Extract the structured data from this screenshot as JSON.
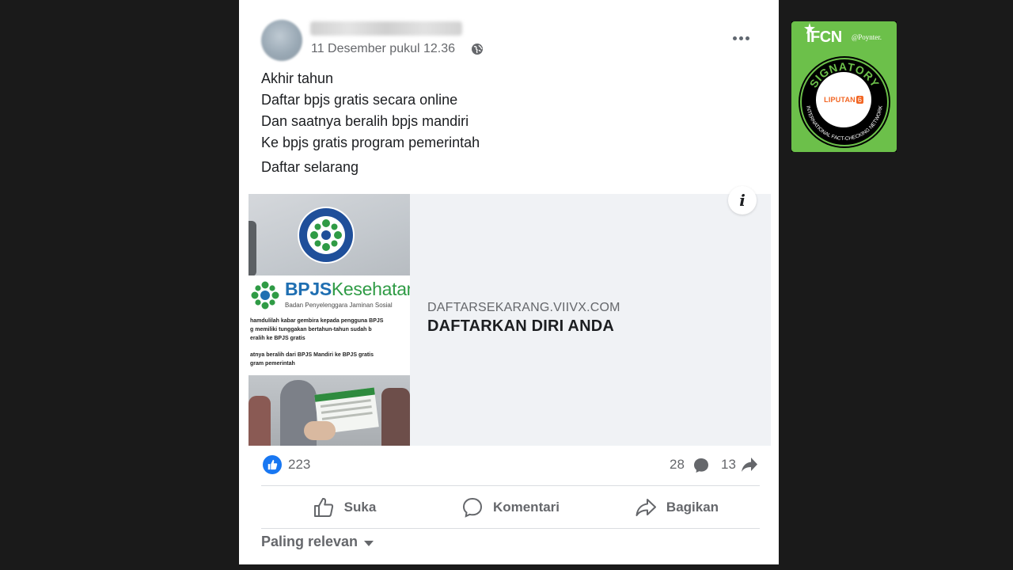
{
  "post": {
    "timestamp": "11 Desember pukul 12.36",
    "privacy_icon": "globe-icon",
    "text_lines": [
      "Akhir tahun",
      "Daftar bpjs gratis secara online",
      "Dan saatnya beralih bpjs mandiri",
      "Ke bpjs gratis program pemerintah"
    ],
    "cta_line": "Daftar selarang"
  },
  "link_preview": {
    "domain": "DAFTARSEKARANG.VIIVX.COM",
    "title": "DAFTARKAN DIRI ANDA",
    "info_label": "i",
    "thumbnail": {
      "brand_main": "BPJS",
      "brand_accent": "Kesehatan",
      "brand_sub": "Badan Penyelenggara Jaminan Sosial",
      "body_lines": [
        "hamdulilah kabar gembira kepada pengguna BPJS",
        "g memiliki tunggakan bertahun-tahun sudah b",
        "eralih ke BPJS gratis",
        "atnya beralih dari BPJS Mandiri ke BPJS gratis",
        "gram pemerintah"
      ]
    }
  },
  "stats": {
    "reactions": "223",
    "comments": "28",
    "shares": "13"
  },
  "actions": {
    "like": "Suka",
    "comment": "Komentari",
    "share": "Bagikan"
  },
  "comments_sort": {
    "label": "Paling relevan"
  },
  "badge": {
    "org": "IFCN",
    "by": "@Poynter.",
    "ring_top": "SIGNATORY",
    "ring_bottom": "INTERNATIONAL FACT-CHECKING NETWORK",
    "member": "LIPUTAN",
    "member_num": "6"
  },
  "colors": {
    "background": "#1a1a1a",
    "card": "#ffffff",
    "facebook_blue": "#1877f2",
    "secondary_text": "#65676b",
    "ifcn_green": "#6cc04a"
  }
}
